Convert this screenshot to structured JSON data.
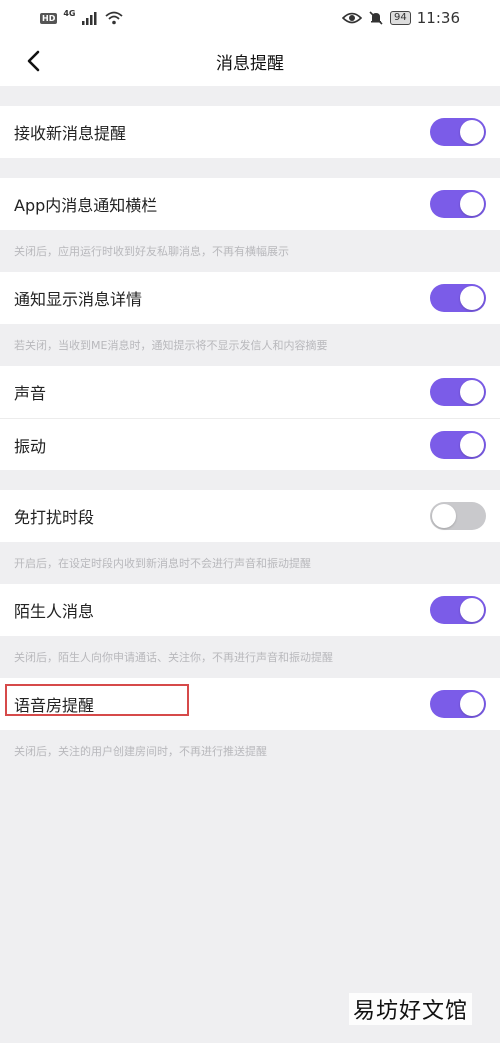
{
  "status_bar": {
    "hd": "HD",
    "network": "4G",
    "battery": "94",
    "time": "11:36"
  },
  "nav": {
    "title": "消息提醒"
  },
  "settings": {
    "receive": {
      "label": "接收新消息提醒",
      "on": true
    },
    "banner": {
      "label": "App内消息通知横栏",
      "on": true,
      "note": "关闭后，应用运行时收到好友私聊消息，不再有横幅展示"
    },
    "details": {
      "label": "通知显示消息详情",
      "on": true,
      "note": "若关闭，当收到ME消息时，通知提示将不显示发信人和内容摘要"
    },
    "sound": {
      "label": "声音",
      "on": true
    },
    "vibrate": {
      "label": "振动",
      "on": true
    },
    "dnd": {
      "label": "免打扰时段",
      "on": false,
      "note": "开启后，在设定时段内收到新消息时不会进行声音和振动提醒"
    },
    "stranger": {
      "label": "陌生人消息",
      "on": true,
      "note": "关闭后，陌生人向你申请通话、关注你，不再进行声音和振动提醒"
    },
    "voice_room": {
      "label": "语音房提醒",
      "on": true,
      "note": "关闭后，关注的用户创建房间时，不再进行推送提醒"
    }
  },
  "colors": {
    "accent": "#7b5ce8",
    "highlight": "#d64a4a"
  },
  "watermark": "易坊好文馆"
}
